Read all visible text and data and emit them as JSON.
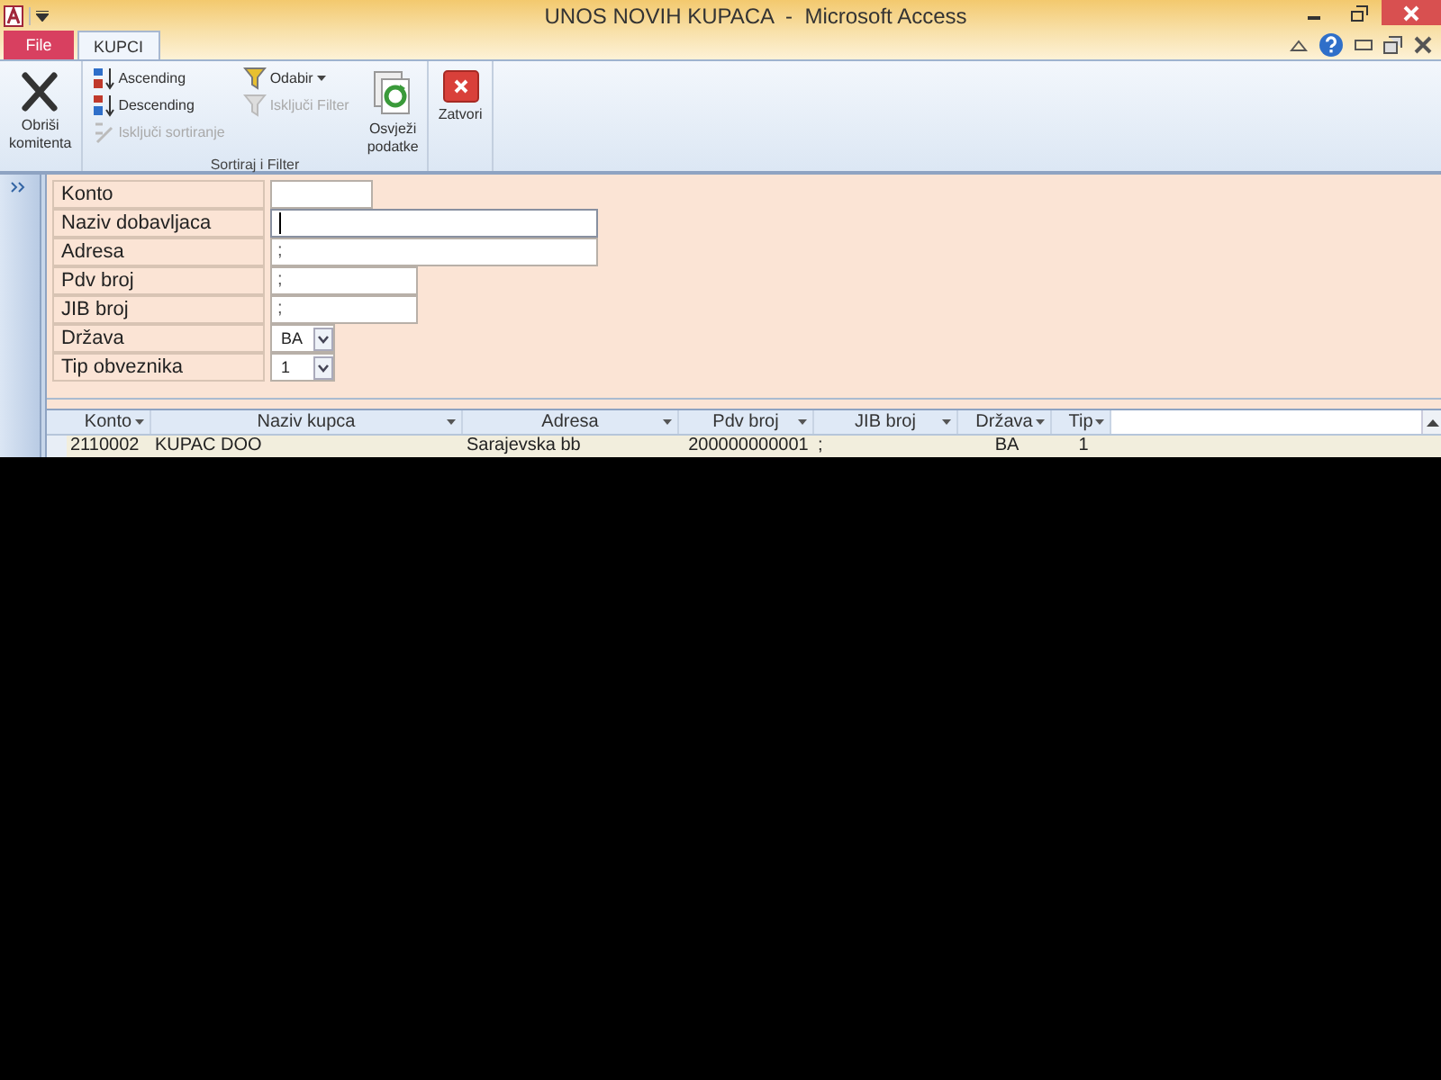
{
  "window": {
    "title": "UNOS NOVIH KUPACA  -  Microsoft Access"
  },
  "tabs": [
    {
      "label": "File",
      "kind": "file",
      "selected": false
    },
    {
      "label": "KUPCI",
      "kind": "tab",
      "selected": true
    }
  ],
  "ribbon": {
    "groups": [
      {
        "items": [
          {
            "kind": "large",
            "label": "Obriši\nkomitenta",
            "disabled": false
          }
        ]
      },
      {
        "label": "Sortiraj i Filter",
        "columns": [
          [
            {
              "kind": "small",
              "label": "Ascending",
              "disabled": false
            },
            {
              "kind": "small",
              "label": "Descending",
              "disabled": false
            },
            {
              "kind": "small",
              "label": "Isključi sortiranje",
              "disabled": true
            }
          ],
          [
            {
              "kind": "small",
              "label": "Odabir",
              "dropdown": true,
              "disabled": false
            },
            {
              "kind": "small",
              "label": "Isključi Filter",
              "disabled": true
            }
          ]
        ],
        "items": [
          {
            "kind": "large",
            "label": "Osvježi\npodatke",
            "disabled": false
          }
        ]
      },
      {
        "items": [
          {
            "kind": "large",
            "label": "Zatvori",
            "disabled": false
          }
        ]
      }
    ]
  },
  "form": {
    "fields": [
      {
        "label": "Konto",
        "kind": "text"
      },
      {
        "label": "Naziv dobavljaca",
        "kind": "text",
        "focused": true
      },
      {
        "label": "Adresa",
        "kind": "text",
        "value": ";"
      },
      {
        "label": "Pdv broj",
        "kind": "text",
        "value": ";"
      },
      {
        "label": "JIB broj",
        "kind": "text",
        "value": ";"
      },
      {
        "label": "Država",
        "kind": "combo",
        "value": "BA"
      },
      {
        "label": "Tip obveznika",
        "kind": "combo",
        "value": "1"
      }
    ]
  },
  "table": {
    "columns": [
      "Konto",
      "Naziv kupca",
      "Adresa",
      "Pdv broj",
      "JIB broj",
      "Država",
      "Tip"
    ],
    "rows": [
      [
        "2110002",
        "KUPAC DOO",
        "Sarajevska bb",
        "200000000001",
        ";",
        "BA",
        "1"
      ]
    ]
  }
}
